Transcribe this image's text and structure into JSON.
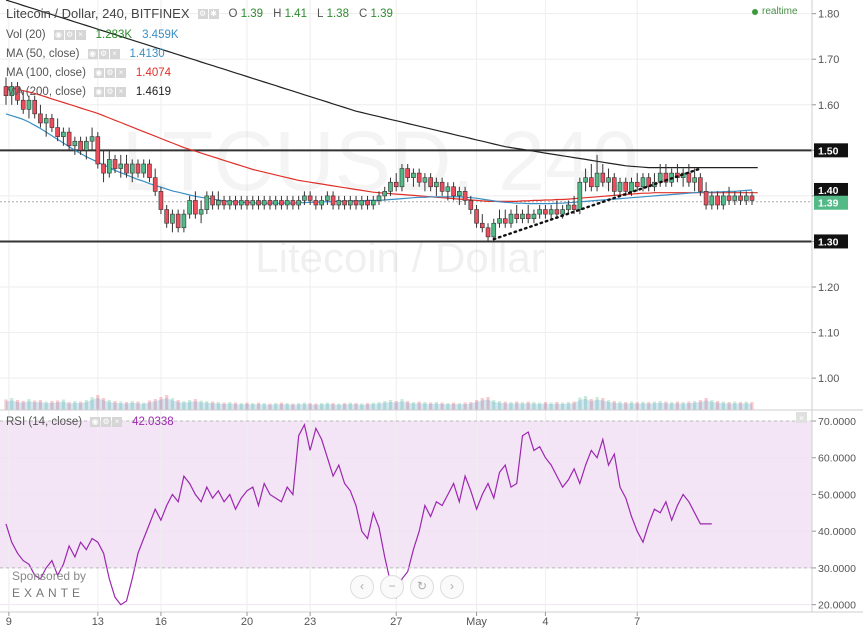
{
  "header": {
    "title": "Litecoin / Dollar, 240, BITFINEX",
    "ohlc": {
      "o_label": "O",
      "o": "1.39",
      "h_label": "H",
      "h": "1.41",
      "l_label": "L",
      "l": "1.38",
      "c_label": "C",
      "c": "1.39"
    },
    "realtime_label": "realtime"
  },
  "studies": [
    {
      "label": "Vol (20)",
      "values": [
        "1.283K",
        "3.459K"
      ],
      "colors": [
        "#2e8b2e",
        "#3a8fc4"
      ]
    },
    {
      "label": "MA (50, close)",
      "values": [
        "1.4130"
      ],
      "colors": [
        "#3a8fc4"
      ]
    },
    {
      "label": "MA (100, close)",
      "values": [
        "1.4074"
      ],
      "colors": [
        "#e0302a"
      ]
    },
    {
      "label": "MA (200, close)",
      "values": [
        "1.4619"
      ],
      "colors": [
        "#222222"
      ]
    }
  ],
  "watermark": {
    "symbol": "LTCUSD, 240",
    "name": "Litecoin / Dollar"
  },
  "price_axis": {
    "ticks": [
      "1.80",
      "1.70",
      "1.60",
      "1.50",
      "1.40",
      "1.30",
      "1.20",
      "1.10",
      "1.00"
    ]
  },
  "hlines": [
    {
      "label": "1.50",
      "value": 1.5
    },
    {
      "label": "1.30",
      "value": 1.3
    }
  ],
  "badges": {
    "level_140": "1.40",
    "last": "1.39"
  },
  "rsi": {
    "label": "RSI (14, close)",
    "value": "42.0338",
    "ticks": [
      "70.0000",
      "60.0000",
      "50.0000",
      "40.0000",
      "30.0000",
      "20.0000"
    ]
  },
  "time_axis": {
    "labels": [
      "9",
      "13",
      "16",
      "20",
      "23",
      "27",
      "May",
      "4",
      "7"
    ]
  },
  "sponsor": {
    "text": "Sponsored by",
    "brand": "EXANTE"
  },
  "nav_buttons": [
    "‹",
    "−",
    "↻",
    "›"
  ],
  "colors": {
    "bull": "#53b987",
    "bear": "#eb4d5c",
    "ma50": "#3a8fc4",
    "ma100": "#e0302a",
    "ma200": "#222222",
    "rsi": "#9c27b0",
    "rsi_bg": "#f3e5f5"
  },
  "chart_data": {
    "type": "candlestick",
    "price_range": [
      0.93,
      1.83
    ],
    "rsi_range": [
      18,
      73
    ],
    "candles": [
      [
        1.64,
        1.66,
        1.6,
        1.62
      ],
      [
        1.62,
        1.65,
        1.6,
        1.64
      ],
      [
        1.64,
        1.65,
        1.6,
        1.61
      ],
      [
        1.61,
        1.63,
        1.58,
        1.59
      ],
      [
        1.59,
        1.62,
        1.57,
        1.61
      ],
      [
        1.61,
        1.62,
        1.57,
        1.58
      ],
      [
        1.58,
        1.6,
        1.55,
        1.56
      ],
      [
        1.56,
        1.58,
        1.53,
        1.57
      ],
      [
        1.57,
        1.58,
        1.54,
        1.55
      ],
      [
        1.55,
        1.57,
        1.52,
        1.53
      ],
      [
        1.53,
        1.55,
        1.51,
        1.54
      ],
      [
        1.54,
        1.55,
        1.5,
        1.51
      ],
      [
        1.51,
        1.53,
        1.49,
        1.52
      ],
      [
        1.52,
        1.53,
        1.49,
        1.5
      ],
      [
        1.5,
        1.53,
        1.48,
        1.52
      ],
      [
        1.52,
        1.55,
        1.5,
        1.53
      ],
      [
        1.53,
        1.54,
        1.46,
        1.47
      ],
      [
        1.47,
        1.5,
        1.43,
        1.45
      ],
      [
        1.45,
        1.5,
        1.44,
        1.48
      ],
      [
        1.48,
        1.49,
        1.45,
        1.46
      ],
      [
        1.46,
        1.49,
        1.44,
        1.47
      ],
      [
        1.47,
        1.49,
        1.44,
        1.45
      ],
      [
        1.45,
        1.48,
        1.43,
        1.47
      ],
      [
        1.47,
        1.48,
        1.44,
        1.45
      ],
      [
        1.45,
        1.48,
        1.44,
        1.47
      ],
      [
        1.47,
        1.48,
        1.43,
        1.44
      ],
      [
        1.44,
        1.46,
        1.4,
        1.41
      ],
      [
        1.41,
        1.42,
        1.36,
        1.37
      ],
      [
        1.37,
        1.38,
        1.33,
        1.34
      ],
      [
        1.34,
        1.37,
        1.32,
        1.36
      ],
      [
        1.36,
        1.37,
        1.32,
        1.33
      ],
      [
        1.33,
        1.37,
        1.32,
        1.36
      ],
      [
        1.36,
        1.4,
        1.35,
        1.39
      ],
      [
        1.39,
        1.41,
        1.35,
        1.36
      ],
      [
        1.36,
        1.39,
        1.34,
        1.37
      ],
      [
        1.37,
        1.41,
        1.36,
        1.4
      ],
      [
        1.4,
        1.41,
        1.37,
        1.38
      ],
      [
        1.38,
        1.41,
        1.37,
        1.39
      ],
      [
        1.39,
        1.4,
        1.37,
        1.38
      ],
      [
        1.38,
        1.4,
        1.37,
        1.39
      ],
      [
        1.39,
        1.4,
        1.37,
        1.38
      ],
      [
        1.38,
        1.4,
        1.37,
        1.39
      ],
      [
        1.39,
        1.4,
        1.37,
        1.38
      ],
      [
        1.38,
        1.4,
        1.37,
        1.39
      ],
      [
        1.39,
        1.4,
        1.37,
        1.38
      ],
      [
        1.38,
        1.4,
        1.37,
        1.39
      ],
      [
        1.39,
        1.4,
        1.37,
        1.38
      ],
      [
        1.38,
        1.4,
        1.37,
        1.39
      ],
      [
        1.39,
        1.4,
        1.37,
        1.38
      ],
      [
        1.38,
        1.4,
        1.37,
        1.39
      ],
      [
        1.39,
        1.4,
        1.37,
        1.38
      ],
      [
        1.38,
        1.4,
        1.37,
        1.39
      ],
      [
        1.39,
        1.41,
        1.38,
        1.4
      ],
      [
        1.4,
        1.41,
        1.38,
        1.39
      ],
      [
        1.39,
        1.4,
        1.37,
        1.38
      ],
      [
        1.38,
        1.4,
        1.37,
        1.39
      ],
      [
        1.39,
        1.41,
        1.38,
        1.4
      ],
      [
        1.4,
        1.41,
        1.37,
        1.38
      ],
      [
        1.38,
        1.4,
        1.37,
        1.39
      ],
      [
        1.39,
        1.4,
        1.37,
        1.38
      ],
      [
        1.38,
        1.4,
        1.37,
        1.39
      ],
      [
        1.39,
        1.4,
        1.37,
        1.38
      ],
      [
        1.38,
        1.4,
        1.37,
        1.39
      ],
      [
        1.39,
        1.4,
        1.37,
        1.38
      ],
      [
        1.38,
        1.4,
        1.37,
        1.39
      ],
      [
        1.39,
        1.41,
        1.38,
        1.4
      ],
      [
        1.4,
        1.42,
        1.39,
        1.41
      ],
      [
        1.41,
        1.44,
        1.4,
        1.43
      ],
      [
        1.43,
        1.45,
        1.41,
        1.42
      ],
      [
        1.42,
        1.47,
        1.41,
        1.46
      ],
      [
        1.46,
        1.47,
        1.43,
        1.44
      ],
      [
        1.44,
        1.46,
        1.42,
        1.45
      ],
      [
        1.45,
        1.46,
        1.42,
        1.43
      ],
      [
        1.43,
        1.45,
        1.41,
        1.44
      ],
      [
        1.44,
        1.45,
        1.41,
        1.42
      ],
      [
        1.42,
        1.44,
        1.4,
        1.43
      ],
      [
        1.43,
        1.44,
        1.4,
        1.41
      ],
      [
        1.41,
        1.43,
        1.39,
        1.42
      ],
      [
        1.42,
        1.43,
        1.39,
        1.4
      ],
      [
        1.4,
        1.42,
        1.38,
        1.41
      ],
      [
        1.41,
        1.42,
        1.38,
        1.39
      ],
      [
        1.39,
        1.4,
        1.36,
        1.37
      ],
      [
        1.37,
        1.38,
        1.33,
        1.34
      ],
      [
        1.34,
        1.36,
        1.32,
        1.33
      ],
      [
        1.33,
        1.34,
        1.3,
        1.31
      ],
      [
        1.31,
        1.35,
        1.3,
        1.34
      ],
      [
        1.34,
        1.37,
        1.33,
        1.35
      ],
      [
        1.35,
        1.37,
        1.33,
        1.34
      ],
      [
        1.34,
        1.37,
        1.33,
        1.36
      ],
      [
        1.36,
        1.38,
        1.34,
        1.35
      ],
      [
        1.35,
        1.37,
        1.34,
        1.36
      ],
      [
        1.36,
        1.38,
        1.34,
        1.35
      ],
      [
        1.35,
        1.37,
        1.34,
        1.36
      ],
      [
        1.36,
        1.38,
        1.35,
        1.37
      ],
      [
        1.37,
        1.38,
        1.35,
        1.36
      ],
      [
        1.36,
        1.38,
        1.35,
        1.37
      ],
      [
        1.37,
        1.39,
        1.35,
        1.36
      ],
      [
        1.36,
        1.38,
        1.35,
        1.37
      ],
      [
        1.37,
        1.39,
        1.36,
        1.38
      ],
      [
        1.38,
        1.4,
        1.36,
        1.37
      ],
      [
        1.37,
        1.44,
        1.36,
        1.43
      ],
      [
        1.43,
        1.46,
        1.41,
        1.44
      ],
      [
        1.44,
        1.47,
        1.41,
        1.42
      ],
      [
        1.42,
        1.49,
        1.41,
        1.45
      ],
      [
        1.45,
        1.47,
        1.42,
        1.43
      ],
      [
        1.43,
        1.46,
        1.41,
        1.44
      ],
      [
        1.44,
        1.45,
        1.4,
        1.41
      ],
      [
        1.41,
        1.44,
        1.4,
        1.43
      ],
      [
        1.43,
        1.44,
        1.4,
        1.41
      ],
      [
        1.41,
        1.44,
        1.4,
        1.43
      ],
      [
        1.43,
        1.45,
        1.41,
        1.42
      ],
      [
        1.42,
        1.45,
        1.41,
        1.44
      ],
      [
        1.44,
        1.45,
        1.41,
        1.42
      ],
      [
        1.42,
        1.45,
        1.41,
        1.43
      ],
      [
        1.43,
        1.47,
        1.42,
        1.45
      ],
      [
        1.45,
        1.47,
        1.42,
        1.43
      ],
      [
        1.43,
        1.46,
        1.42,
        1.45
      ],
      [
        1.45,
        1.47,
        1.43,
        1.44
      ],
      [
        1.44,
        1.46,
        1.42,
        1.45
      ],
      [
        1.45,
        1.47,
        1.42,
        1.43
      ],
      [
        1.43,
        1.46,
        1.41,
        1.44
      ],
      [
        1.44,
        1.45,
        1.4,
        1.41
      ],
      [
        1.41,
        1.43,
        1.37,
        1.38
      ],
      [
        1.38,
        1.41,
        1.37,
        1.4
      ],
      [
        1.4,
        1.41,
        1.37,
        1.38
      ],
      [
        1.38,
        1.41,
        1.37,
        1.4
      ],
      [
        1.4,
        1.42,
        1.38,
        1.39
      ],
      [
        1.39,
        1.41,
        1.38,
        1.4
      ],
      [
        1.4,
        1.41,
        1.38,
        1.39
      ],
      [
        1.39,
        1.41,
        1.38,
        1.4
      ],
      [
        1.4,
        1.41,
        1.38,
        1.39
      ]
    ],
    "volume": [
      2.1,
      2.4,
      2.0,
      1.8,
      2.2,
      1.9,
      2.0,
      1.7,
      1.8,
      1.9,
      2.1,
      1.6,
      1.8,
      1.7,
      2.0,
      2.6,
      3.0,
      2.4,
      2.0,
      1.8,
      1.7,
      1.6,
      1.8,
      1.7,
      1.5,
      1.9,
      2.2,
      2.6,
      3.0,
      2.4,
      2.0,
      1.8,
      2.0,
      2.2,
      1.9,
      1.8,
      1.7,
      1.6,
      1.5,
      1.6,
      1.5,
      1.4,
      1.5,
      1.4,
      1.5,
      1.4,
      1.3,
      1.4,
      1.5,
      1.4,
      1.3,
      1.4,
      1.5,
      1.4,
      1.3,
      1.4,
      1.5,
      1.4,
      1.3,
      1.4,
      1.5,
      1.4,
      1.3,
      1.4,
      1.5,
      1.6,
      1.8,
      2.0,
      1.8,
      2.2,
      1.8,
      1.6,
      1.7,
      1.6,
      1.5,
      1.6,
      1.5,
      1.4,
      1.5,
      1.4,
      1.5,
      1.6,
      2.0,
      2.4,
      2.6,
      2.0,
      1.8,
      1.7,
      1.6,
      1.7,
      1.6,
      1.7,
      1.6,
      1.5,
      1.6,
      1.5,
      1.6,
      1.5,
      1.6,
      1.7,
      2.5,
      2.8,
      2.2,
      2.6,
      2.4,
      2.0,
      1.8,
      1.7,
      1.6,
      1.7,
      1.6,
      1.7,
      1.6,
      1.7,
      1.8,
      1.7,
      1.6,
      1.7,
      1.6,
      1.7,
      1.8,
      2.0,
      2.4,
      2.0,
      1.8,
      1.7,
      1.6,
      1.7,
      1.6,
      1.7,
      1.6
    ],
    "ma50": [
      1.58,
      1.576,
      1.572,
      1.568,
      1.562,
      1.555,
      1.548,
      1.54,
      1.532,
      1.524,
      1.516,
      1.508,
      1.5,
      1.493,
      1.486,
      1.48,
      1.474,
      1.468,
      1.462,
      1.456,
      1.451,
      1.446,
      1.441,
      1.436,
      1.432,
      1.427,
      1.423,
      1.419,
      1.415,
      1.411,
      1.408,
      1.405,
      1.402,
      1.399,
      1.397,
      1.395,
      1.393,
      1.391,
      1.389,
      1.388,
      1.387,
      1.386,
      1.385,
      1.385,
      1.384,
      1.384,
      1.384,
      1.384,
      1.384,
      1.384,
      1.384,
      1.385,
      1.385,
      1.386,
      1.386,
      1.387,
      1.387,
      1.388,
      1.388,
      1.388,
      1.389,
      1.389,
      1.389,
      1.39,
      1.39,
      1.39,
      1.391,
      1.392,
      1.393,
      1.394,
      1.395,
      1.396,
      1.397,
      1.397,
      1.398,
      1.398,
      1.398,
      1.398,
      1.398,
      1.398,
      1.397,
      1.396,
      1.395,
      1.393,
      1.391,
      1.389,
      1.387,
      1.386,
      1.385,
      1.384,
      1.384,
      1.383,
      1.383,
      1.383,
      1.383,
      1.383,
      1.384,
      1.384,
      1.385,
      1.386,
      1.387,
      1.388,
      1.389,
      1.39,
      1.391,
      1.392,
      1.393,
      1.394,
      1.395,
      1.396,
      1.397,
      1.398,
      1.399,
      1.4,
      1.401,
      1.402,
      1.403,
      1.404,
      1.405,
      1.406,
      1.407,
      1.408,
      1.408,
      1.408,
      1.409,
      1.409,
      1.41,
      1.41,
      1.411,
      1.412,
      1.413
    ],
    "ma100": [
      1.64,
      1.637,
      1.634,
      1.631,
      1.628,
      1.625,
      1.621,
      1.617,
      1.613,
      1.609,
      1.605,
      1.601,
      1.597,
      1.593,
      1.589,
      1.585,
      1.581,
      1.576,
      1.571,
      1.566,
      1.561,
      1.556,
      1.551,
      1.546,
      1.541,
      1.536,
      1.531,
      1.526,
      1.521,
      1.516,
      1.511,
      1.506,
      1.502,
      1.498,
      1.494,
      1.49,
      1.486,
      1.482,
      1.478,
      1.474,
      1.47,
      1.466,
      1.462,
      1.458,
      1.455,
      1.452,
      1.449,
      1.446,
      1.443,
      1.44,
      1.437,
      1.434,
      1.432,
      1.43,
      1.428,
      1.426,
      1.424,
      1.422,
      1.42,
      1.418,
      1.416,
      1.414,
      1.412,
      1.41,
      1.408,
      1.407,
      1.406,
      1.405,
      1.404,
      1.403,
      1.402,
      1.401,
      1.4,
      1.399,
      1.398,
      1.397,
      1.396,
      1.395,
      1.394,
      1.393,
      1.392,
      1.391,
      1.39,
      1.389,
      1.388,
      1.388,
      1.388,
      1.388,
      1.388,
      1.388,
      1.389,
      1.389,
      1.39,
      1.39,
      1.391,
      1.391,
      1.392,
      1.392,
      1.393,
      1.394,
      1.395,
      1.396,
      1.397,
      1.398,
      1.399,
      1.4,
      1.401,
      1.402,
      1.403,
      1.404,
      1.405,
      1.406,
      1.406,
      1.407,
      1.407,
      1.407,
      1.407,
      1.407,
      1.407,
      1.407,
      1.407,
      1.407,
      1.407,
      1.407,
      1.407,
      1.407,
      1.407,
      1.407,
      1.407,
      1.407,
      1.407,
      1.407
    ],
    "ma200": [
      1.83,
      1.826,
      1.822,
      1.818,
      1.814,
      1.81,
      1.806,
      1.802,
      1.798,
      1.794,
      1.79,
      1.786,
      1.782,
      1.778,
      1.774,
      1.77,
      1.766,
      1.762,
      1.758,
      1.754,
      1.75,
      1.746,
      1.742,
      1.738,
      1.734,
      1.73,
      1.726,
      1.722,
      1.718,
      1.714,
      1.71,
      1.706,
      1.702,
      1.698,
      1.694,
      1.69,
      1.686,
      1.682,
      1.678,
      1.674,
      1.67,
      1.666,
      1.662,
      1.658,
      1.654,
      1.65,
      1.646,
      1.642,
      1.638,
      1.634,
      1.63,
      1.626,
      1.622,
      1.618,
      1.614,
      1.61,
      1.606,
      1.602,
      1.598,
      1.594,
      1.59,
      1.586,
      1.583,
      1.58,
      1.577,
      1.574,
      1.571,
      1.568,
      1.565,
      1.562,
      1.559,
      1.556,
      1.553,
      1.55,
      1.547,
      1.544,
      1.541,
      1.538,
      1.535,
      1.532,
      1.529,
      1.526,
      1.523,
      1.52,
      1.517,
      1.514,
      1.511,
      1.508,
      1.506,
      1.504,
      1.502,
      1.5,
      1.498,
      1.496,
      1.494,
      1.492,
      1.49,
      1.488,
      1.486,
      1.484,
      1.482,
      1.48,
      1.478,
      1.476,
      1.474,
      1.472,
      1.47,
      1.468,
      1.466,
      1.465,
      1.464,
      1.463,
      1.462,
      1.462,
      1.462,
      1.462,
      1.462,
      1.462,
      1.462,
      1.462,
      1.462,
      1.462,
      1.462,
      1.462,
      1.462,
      1.462,
      1.462,
      1.462,
      1.462,
      1.462,
      1.462,
      1.462
    ],
    "rsi": [
      42,
      37,
      34,
      32,
      31,
      28,
      27,
      30,
      32,
      28,
      31,
      36,
      33,
      37,
      35,
      38,
      37,
      34,
      27,
      22,
      20,
      21,
      27,
      34,
      38,
      42,
      46,
      43,
      47,
      50,
      48,
      55,
      53,
      50,
      48,
      52,
      49,
      51,
      48,
      50,
      46,
      49,
      51,
      52,
      47,
      53,
      50,
      49,
      48,
      52,
      50,
      66,
      69,
      62,
      68,
      65,
      60,
      55,
      58,
      53,
      51,
      47,
      40,
      38,
      45,
      41,
      33,
      26,
      22,
      27,
      29,
      35,
      40,
      47,
      44,
      48,
      47,
      50,
      53,
      48,
      55,
      51,
      46,
      50,
      53,
      49,
      56,
      58,
      52,
      53,
      66,
      67,
      62,
      63,
      60,
      58,
      55,
      52,
      54,
      57,
      53,
      58,
      62,
      60,
      65,
      58,
      61,
      52,
      49,
      44,
      40,
      37,
      42,
      46,
      45,
      48,
      43,
      47,
      50,
      48,
      45,
      42,
      42,
      42
    ]
  }
}
